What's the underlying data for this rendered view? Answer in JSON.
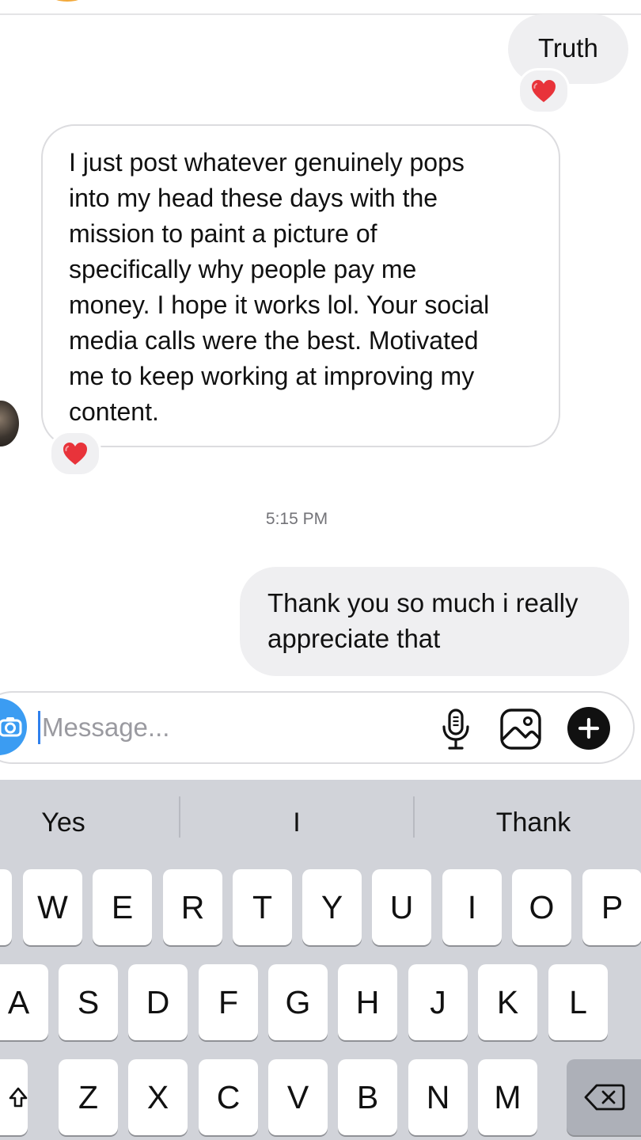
{
  "messages": {
    "truth_text": "Truth",
    "incoming_lines": [
      "I just post whatever genuinely pops",
      "into my head these days with the",
      "mission to paint a picture of",
      "specifically why people pay me",
      "money. I hope it works lol. Your social",
      "media calls were the best. Motivated",
      "me to keep working at improving my",
      "content."
    ],
    "reaction_emoji": "heart",
    "timestamp": "5:15 PM",
    "outgoing_lines": [
      "Thank you so much i really",
      "appreciate that"
    ]
  },
  "composer": {
    "placeholder": "Message...",
    "value": "",
    "icons": [
      "camera-icon",
      "microphone-icon",
      "gallery-icon",
      "plus-icon"
    ]
  },
  "keyboard": {
    "suggestions": [
      "Yes",
      "I",
      "Thank"
    ],
    "row1": [
      "W",
      "E",
      "R",
      "T",
      "Y",
      "U",
      "I",
      "O",
      "P"
    ],
    "row2": [
      "A",
      "S",
      "D",
      "F",
      "G",
      "H",
      "J",
      "K",
      "L"
    ],
    "row3": [
      "Z",
      "X",
      "C",
      "V",
      "B",
      "N",
      "M"
    ],
    "special_keys": [
      "shift-icon",
      "backspace-icon"
    ]
  },
  "colors": {
    "incoming_border": "#dcdcdf",
    "outgoing_bubble": "#efeff1",
    "accent": "#3b9cf2",
    "heart": "#e8333a",
    "keyboard_bg": "#d1d3d9"
  }
}
